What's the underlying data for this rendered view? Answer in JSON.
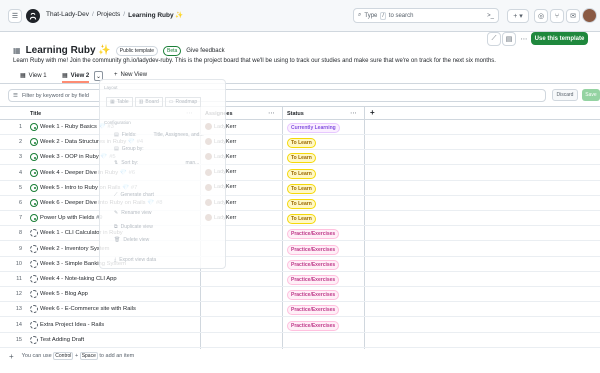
{
  "header": {
    "breadcrumbs": [
      "That-Lady-Dev",
      "Projects",
      "Learning Ruby ✨"
    ],
    "search_prefix": "Type",
    "search_key": "/",
    "search_suffix": "to search",
    "plus_label": "+ ▾"
  },
  "project": {
    "title": "Learning Ruby ✨",
    "badge_public": "Public template",
    "badge_beta": "Beta",
    "feedback": "Give feedback",
    "description": "Learn Ruby with me! Join the community gh.io/ladydev-ruby. This is the project board that we'll be using to track our studies and make sure that we're on track for the next six months.",
    "use_template": "Use this template"
  },
  "tabs": [
    "View 1",
    "View 2",
    "New View"
  ],
  "filter": {
    "placeholder": "Filter by keyword or by field",
    "discard": "Discard",
    "save": "Save"
  },
  "columns": {
    "title": "Title",
    "assignees": "Assignees",
    "status": "Status"
  },
  "rows": [
    {
      "n": "1",
      "title": "Week 1 - Ruby Basics 💎",
      "num": "#3",
      "type": "issue",
      "assignee": "LadyKerr",
      "status": "Currently Learning",
      "color": "purple"
    },
    {
      "n": "2",
      "title": "Week 2 - Data Structures in Ruby 💎",
      "num": "#4",
      "type": "issue",
      "assignee": "LadyKerr",
      "status": "To Learn",
      "color": "orange"
    },
    {
      "n": "3",
      "title": "Week 3 - OOP in Ruby 💎",
      "num": "#5",
      "type": "issue",
      "assignee": "LadyKerr",
      "status": "To Learn",
      "color": "orange"
    },
    {
      "n": "4",
      "title": "Week 4 - Deeper Dive in Ruby 💎",
      "num": "#6",
      "type": "issue",
      "assignee": "LadyKerr",
      "status": "To Learn",
      "color": "orange"
    },
    {
      "n": "5",
      "title": "Week 5 - Intro to Ruby on Rails 💎",
      "num": "#7",
      "type": "issue",
      "assignee": "LadyKerr",
      "status": "To Learn",
      "color": "orange"
    },
    {
      "n": "6",
      "title": "Week 6 - Deeper Dive into Ruby on Rails 💎",
      "num": "#8",
      "type": "issue",
      "assignee": "LadyKerr",
      "status": "To Learn",
      "color": "orange"
    },
    {
      "n": "7",
      "title": "Power Up with Fields",
      "num": "#9",
      "type": "issue",
      "assignee": "LadyKerr",
      "status": "To Learn",
      "color": "orange"
    },
    {
      "n": "8",
      "title": "Week 1 - CLI Calculator in Ruby",
      "num": "",
      "type": "draft",
      "assignee": "",
      "status": "Practice/Exercises",
      "color": "pink"
    },
    {
      "n": "9",
      "title": "Week 2 - Inventory System",
      "num": "",
      "type": "draft",
      "assignee": "",
      "status": "Practice/Exercises",
      "color": "pink"
    },
    {
      "n": "10",
      "title": "Week 3 - Simple Banking System",
      "num": "",
      "type": "draft",
      "assignee": "",
      "status": "Practice/Exercises",
      "color": "pink"
    },
    {
      "n": "11",
      "title": "Week 4 - Note-taking CLI App",
      "num": "",
      "type": "draft",
      "assignee": "",
      "status": "Practice/Exercises",
      "color": "pink"
    },
    {
      "n": "12",
      "title": "Week 5 - Blog App",
      "num": "",
      "type": "draft",
      "assignee": "",
      "status": "Practice/Exercises",
      "color": "pink"
    },
    {
      "n": "13",
      "title": "Week 6 - E-Commerce site with Rails",
      "num": "",
      "type": "draft",
      "assignee": "",
      "status": "Practice/Exercises",
      "color": "pink"
    },
    {
      "n": "14",
      "title": "Extra Project Idea - Rails",
      "num": "",
      "type": "draft",
      "assignee": "",
      "status": "Practice/Exercises",
      "color": "pink"
    },
    {
      "n": "15",
      "title": "Test Adding Draft",
      "num": "",
      "type": "draft",
      "assignee": "",
      "status": "",
      "color": ""
    }
  ],
  "status_colors": {
    "purple": {
      "bg": "#fbefff",
      "fg": "#8250df",
      "border": "#e7c8ff"
    },
    "orange": {
      "bg": "#fff8c5",
      "fg": "#9a6700",
      "border": "#f5d90a"
    },
    "pink": {
      "bg": "#ffeff7",
      "fg": "#bf3989",
      "border": "#ffc0de"
    }
  },
  "add_item": {
    "prefix": "You can use",
    "key1": "Control",
    "plus": "+",
    "key2": "Space",
    "suffix": "to add an item"
  },
  "menu": {
    "layout_heading": "Layout",
    "layouts": [
      "Table",
      "Board",
      "Roadmap"
    ],
    "config_heading": "Configuration",
    "fields": "Fields:",
    "fields_value": "Title, Assignees, and...",
    "group_by": "Group by:",
    "sort_by": "Sort by:",
    "sort_value": "man...",
    "generate_chart": "Generate chart",
    "rename_view": "Rename view",
    "duplicate_view": "Duplicate view",
    "delete_view": "Delete view",
    "export_view": "Export view data"
  }
}
